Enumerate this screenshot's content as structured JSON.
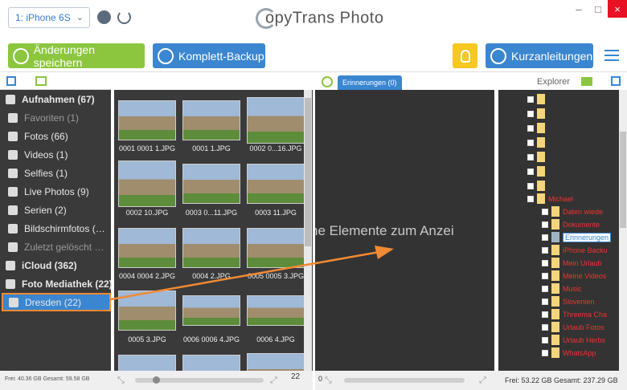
{
  "device": {
    "selected": "1: iPhone 6S"
  },
  "app": {
    "title_rest": "opyTrans Photo",
    "title_c": "C"
  },
  "toolbar": {
    "save_label": "Änderungen speichern",
    "backup_label": "Komplett-Backup",
    "guides_label": "Kurzanleitungen"
  },
  "sidebar": {
    "items": [
      {
        "label": "Aufnahmen (67)",
        "icon": "inbox-icon"
      },
      {
        "label": "Favoriten (1)",
        "icon": "heart-icon"
      },
      {
        "label": "Fotos (66)",
        "icon": "camera-icon"
      },
      {
        "label": "Videos (1)",
        "icon": "video-icon"
      },
      {
        "label": "Selfies (1)",
        "icon": "selfie-icon"
      },
      {
        "label": "Live Photos (9)",
        "icon": "live-photo-icon"
      },
      {
        "label": "Serien (2)",
        "icon": "burst-icon"
      },
      {
        "label": "Bildschirmfotos (…",
        "icon": "screenshot-icon"
      },
      {
        "label": "Zuletzt gelöscht …",
        "icon": "trash-icon"
      },
      {
        "label": "iCloud (362)",
        "icon": "cloud-icon"
      },
      {
        "label": "Foto Mediathek (22)",
        "icon": "library-icon"
      },
      {
        "label": "Dresden (22)",
        "icon": "album-icon"
      }
    ],
    "footer": "Frei: 40.36 GB Gesamt: 59.58 GB"
  },
  "photos": {
    "items": [
      "0001 0001 1.JPG",
      "0001 1.JPG",
      "0002 0...16.JPG",
      "0002 10.JPG",
      "0003 0...11.JPG",
      "0003 11.JPG",
      "0004 0004 2.JPG",
      "0004 2.JPG",
      "0005 0005 3.JPG",
      "0005 3.JPG",
      "0006 0006 4.JPG",
      "0006 4.JPG"
    ],
    "count": "22"
  },
  "middle": {
    "tab": "Erinnerungen (0)",
    "empty_text": "ne Elemente zum Anzei",
    "count": "0"
  },
  "explorer": {
    "title": "Explorer",
    "items": [
      "Michael",
      "Daten wiede",
      "Dokumente",
      "Erinnerungen",
      "iPhone Backu",
      "Mein Urlaub",
      "Meine Videos",
      "Music",
      "Slovenien",
      "Threema Cha",
      "Urlaub Fotos",
      "Urlaub Herbs",
      "WhatsApp"
    ],
    "footer": "Frei: 53.22 GB Gesamt: 237.29 GB"
  }
}
